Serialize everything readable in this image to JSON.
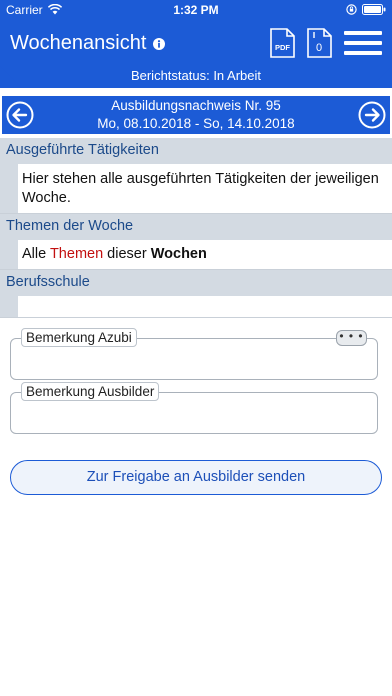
{
  "statusbar": {
    "carrier": "Carrier",
    "time": "1:32 PM"
  },
  "header": {
    "title": "Wochenansicht",
    "pdf_label": "PDF",
    "count_label": "0",
    "status_text": "Berichtstatus: In Arbeit"
  },
  "nav": {
    "line1": "Ausbildungsnachweis Nr. 95",
    "line2": "Mo, 08.10.2018 - So, 14.10.2018"
  },
  "sections": {
    "activities": {
      "title": "Ausgeführte Tätigkeiten",
      "text": "Hier stehen alle ausgeführten Tätigkeiten der jeweiligen Woche."
    },
    "themes": {
      "title": "Themen der Woche",
      "text_part1": "Alle ",
      "text_part2": "Themen",
      "text_part3": " dieser ",
      "text_part4": "Wochen"
    },
    "school": {
      "title": "Berufsschule",
      "text": ""
    }
  },
  "remarks": {
    "azubi_label": "Bemerkung Azubi",
    "more_label": "• • •",
    "ausbilder_label": "Bemerkung Ausbilder"
  },
  "actions": {
    "send_label": "Zur Freigabe an Ausbilder senden"
  },
  "colors": {
    "brand": "#1c5bd6",
    "section_bg": "#d3dae2",
    "section_text": "#1c4a8a",
    "highlight": "#c21010"
  }
}
